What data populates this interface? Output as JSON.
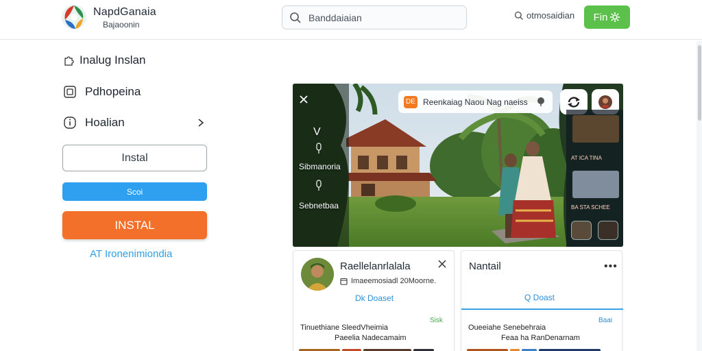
{
  "header": {
    "brand_title": "NapdGanaia",
    "brand_sub": "Bajaoonin",
    "search_placeholder": "Banddaiaian",
    "search_link": "otmosaidian",
    "action_button": "Fin"
  },
  "sidebar": {
    "items": [
      {
        "label": "Inalug Inslan",
        "icon": "puzzle-icon"
      },
      {
        "label": "Pdhopeina",
        "icon": "app-icon"
      },
      {
        "label": "Hoalian",
        "icon": "info-icon"
      }
    ],
    "install_outline": "Instal",
    "blue_button": "Scoi",
    "install_primary": "INSTAL",
    "link": "AT Ironenimiondia"
  },
  "hero": {
    "pill_badge": "DE",
    "pill_text": "Reenkaiag Naou Nag naeiss",
    "left_texts": [
      "V",
      "Sibmanoria",
      "Sebnetbaa"
    ],
    "right_labels": [
      "AT ICA TINA",
      "BA STA SCHEE"
    ]
  },
  "cards": [
    {
      "title": "Raellelanrlalala",
      "meta": "Imaeemosiadl 20Moorne.",
      "link": "Dk Doaset",
      "green": "Sisk",
      "line1": "Tinuethiane SleedVheimia",
      "line2": "Paeelia Nadecamaim"
    },
    {
      "title": "Nantail",
      "link": "Q Doast",
      "green": "Baai",
      "line1": "Oueeiahe Senebehraia",
      "line2": "Feaa ha RanDenarnam"
    }
  ],
  "colors": {
    "accent_green": "#5cc14a",
    "accent_blue": "#2f9ff0",
    "accent_orange": "#f2702a",
    "link_blue": "#2aa0e6"
  }
}
